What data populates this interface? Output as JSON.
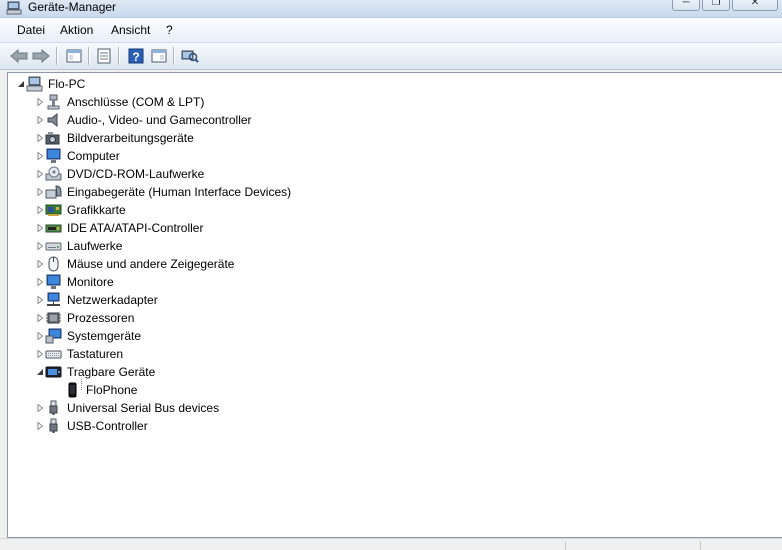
{
  "window": {
    "title": "Geräte-Manager"
  },
  "menubar": {
    "items": [
      "Datei",
      "Aktion",
      "Ansicht",
      "?"
    ]
  },
  "toolbar": {
    "buttons": [
      {
        "icon": "back-arrow-icon"
      },
      {
        "icon": "forward-arrow-icon"
      },
      {
        "icon": "console-tree-icon"
      },
      {
        "icon": "properties-icon"
      },
      {
        "icon": "help-icon"
      },
      {
        "icon": "show-action-pane-icon"
      },
      {
        "icon": "scan-hardware-icon"
      }
    ]
  },
  "tree": {
    "root": {
      "label": "Flo-PC",
      "icon": "computer-root-icon",
      "expanded": true
    },
    "categories": [
      {
        "label": "Anschlüsse (COM & LPT)",
        "icon": "port-icon"
      },
      {
        "label": "Audio-, Video- und Gamecontroller",
        "icon": "speaker-icon"
      },
      {
        "label": "Bildverarbeitungsgeräte",
        "icon": "camera-icon"
      },
      {
        "label": "Computer",
        "icon": "monitor-icon"
      },
      {
        "label": "DVD/CD-ROM-Laufwerke",
        "icon": "disc-drive-icon"
      },
      {
        "label": "Eingabegeräte (Human Interface Devices)",
        "icon": "hid-icon"
      },
      {
        "label": "Grafikkarte",
        "icon": "display-adapter-icon"
      },
      {
        "label": "IDE ATA/ATAPI-Controller",
        "icon": "ide-controller-icon"
      },
      {
        "label": "Laufwerke",
        "icon": "disk-drive-icon"
      },
      {
        "label": "Mäuse und andere Zeigegeräte",
        "icon": "mouse-icon"
      },
      {
        "label": "Monitore",
        "icon": "monitor-icon"
      },
      {
        "label": "Netzwerkadapter",
        "icon": "network-adapter-icon"
      },
      {
        "label": "Prozessoren",
        "icon": "processor-icon"
      },
      {
        "label": "Systemgeräte",
        "icon": "system-devices-icon"
      },
      {
        "label": "Tastaturen",
        "icon": "keyboard-icon"
      },
      {
        "label": "Tragbare Geräte",
        "icon": "portable-device-icon",
        "expanded": true,
        "children": [
          {
            "label": "FloPhone",
            "icon": "phone-icon"
          }
        ]
      },
      {
        "label": "Universal Serial Bus devices",
        "icon": "usb-plug-icon"
      },
      {
        "label": "USB-Controller",
        "icon": "usb-plug-icon"
      }
    ]
  }
}
